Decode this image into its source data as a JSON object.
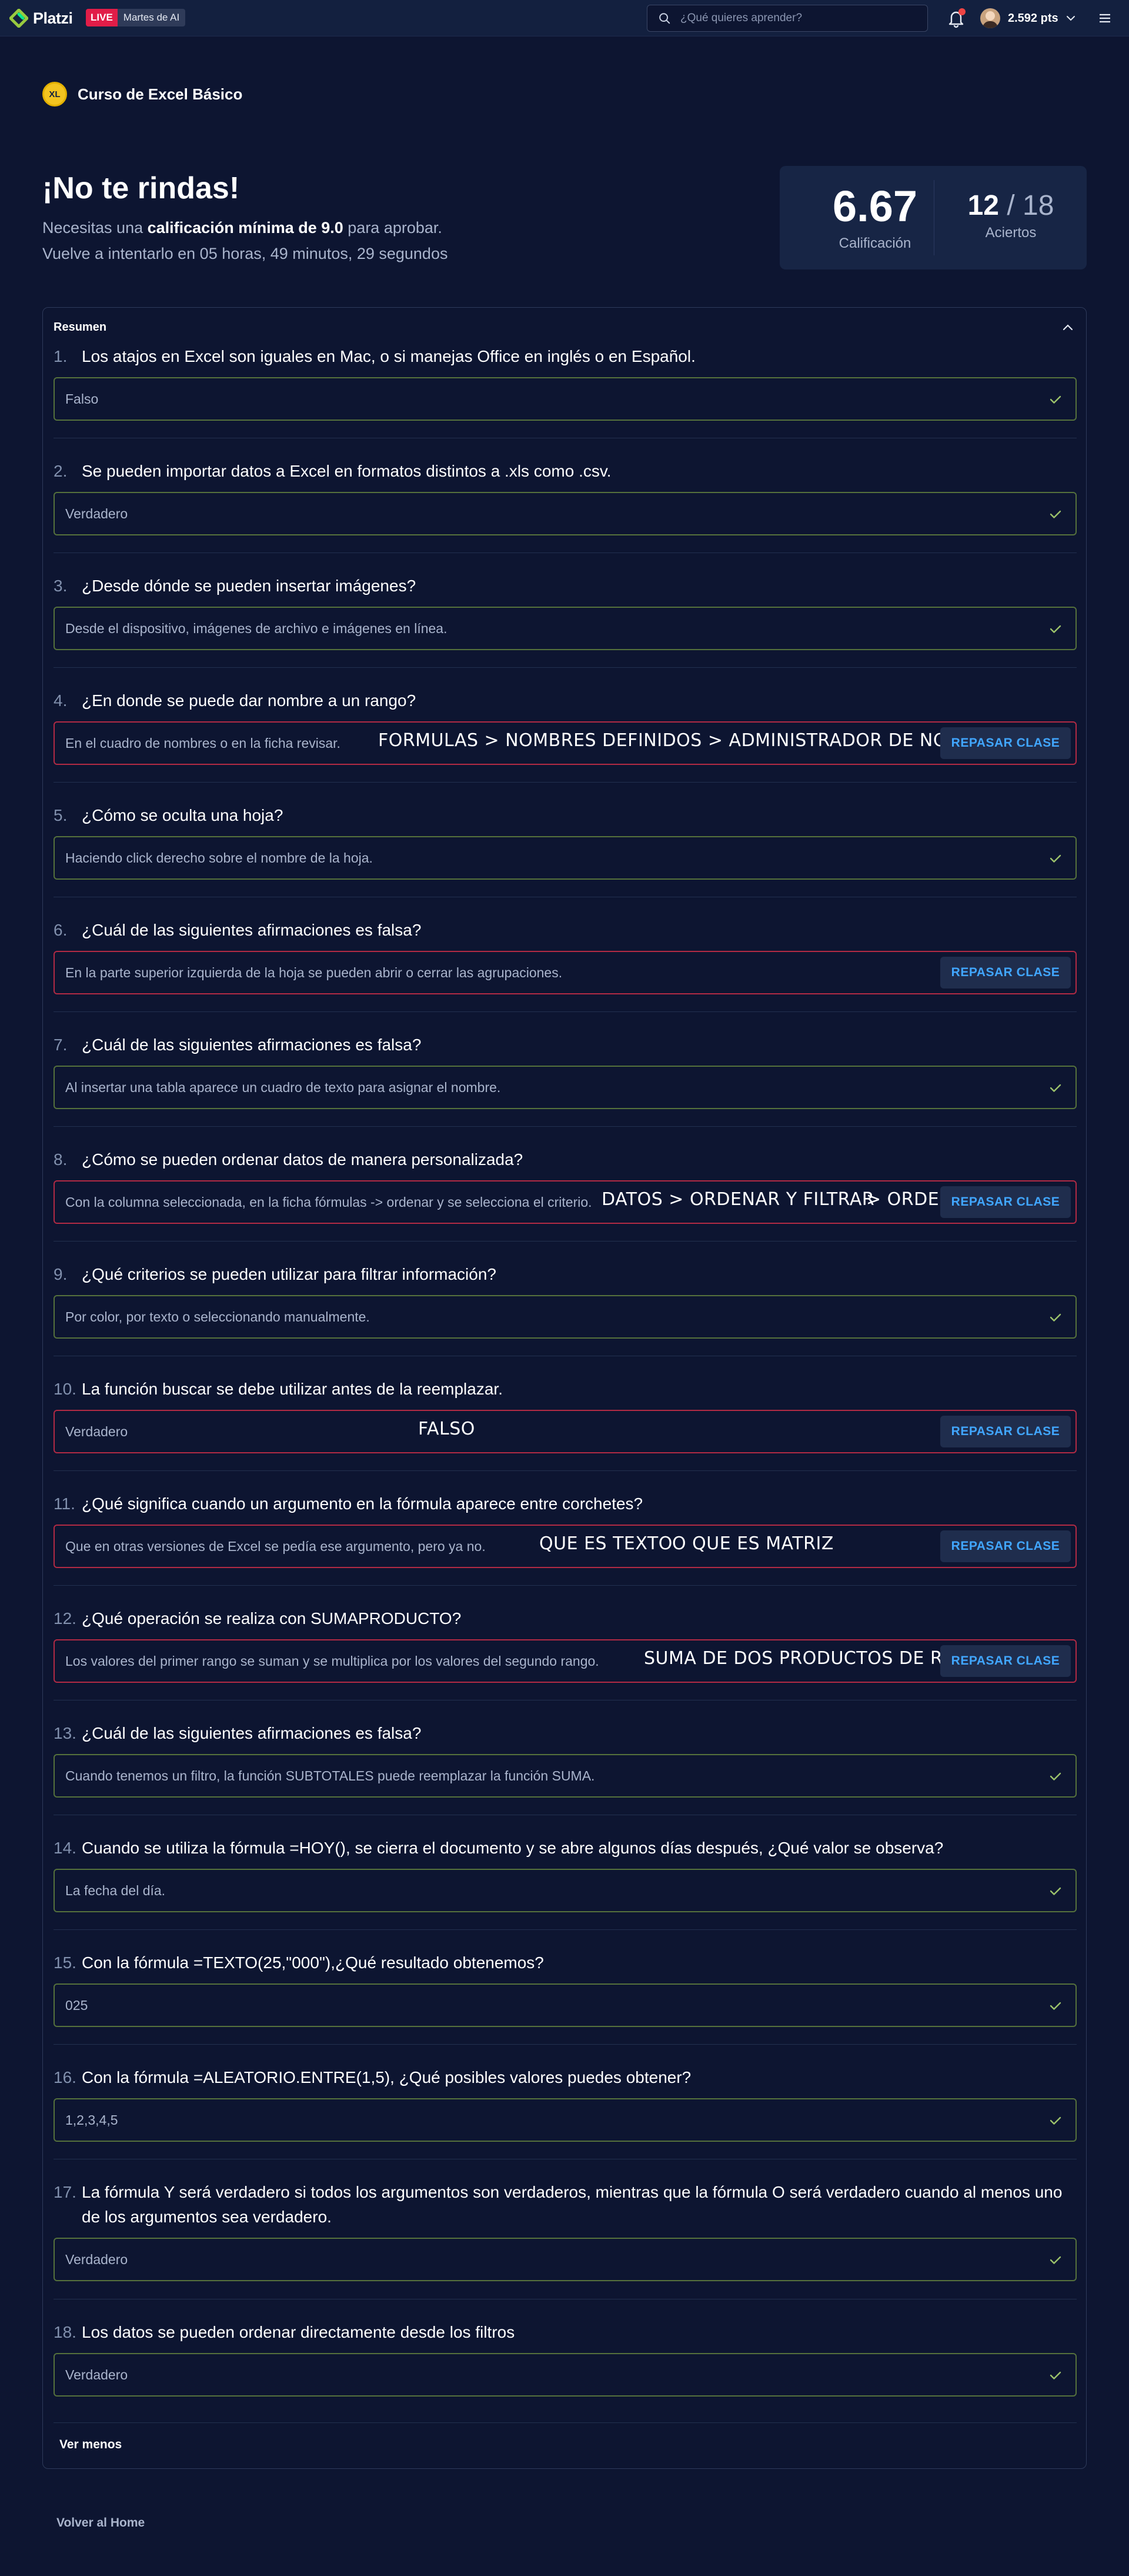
{
  "header": {
    "brand": "Platzi",
    "live_label": "LIVE",
    "live_event": "Martes de AI",
    "search_placeholder": "¿Qué quieres aprender?",
    "points": "2.592 pts"
  },
  "course": {
    "badge": "XL",
    "name": "Curso de Excel Básico"
  },
  "result": {
    "heading": "¡No te rindas!",
    "requirement_prefix": "Necesitas una",
    "requirement_bold": "calificación mínima de 9.0",
    "requirement_suffix": "para aprobar.",
    "retry": "Vuelve a intentarlo en 05 horas, 49 minutos, 29 segundos",
    "score": "6.67",
    "score_label": "Calificación",
    "hits": "12",
    "hits_total": "/ 18",
    "hits_label": "Aciertos"
  },
  "summary": {
    "title": "Resumen",
    "review_label": "REPASAR CLASE",
    "show_less": "Ver menos",
    "questions": [
      {
        "num": "1.",
        "text": "Los atajos en Excel son iguales en Mac, o si manejas Office en inglés o en Español.",
        "answer": "Falso"
      },
      {
        "num": "2.",
        "text": "Se pueden importar datos a Excel en formatos distintos a .xls como .csv.",
        "answer": "Verdadero"
      },
      {
        "num": "3.",
        "text": "¿Desde dónde se pueden insertar imágenes?",
        "answer": "Desde el dispositivo, imágenes de archivo e imágenes en línea."
      },
      {
        "num": "4.",
        "text": "¿En donde se puede dar nombre a un rango?",
        "answer": "En el cuadro de nombres o en la ficha revisar.",
        "note": "FORMULAS > NOMBRES DEFINIDOS > ADMINISTRADOR DE NOMBRES"
      },
      {
        "num": "5.",
        "text": "¿Cómo se oculta una hoja?",
        "answer": "Haciendo click derecho sobre el nombre de la hoja."
      },
      {
        "num": "6.",
        "text": "¿Cuál de las siguientes afirmaciones es falsa?",
        "answer": "En la parte superior izquierda de la hoja se pueden abrir o cerrar las agrupaciones."
      },
      {
        "num": "7.",
        "text": "¿Cuál de las siguientes afirmaciones es falsa?",
        "answer": "Al insertar una tabla aparece un cuadro de texto para asignar el nombre."
      },
      {
        "num": "8.",
        "text": "¿Cómo se pueden ordenar datos de manera personalizada?",
        "answer": "Con la columna seleccionada, en la ficha fórmulas -> ordenar y se selecciona el criterio.",
        "note": "DATOS > ORDENAR Y FILTRAR",
        "note2": "> ORDENAR"
      },
      {
        "num": "9.",
        "text": "¿Qué criterios se pueden utilizar para filtrar información?",
        "answer": "Por color, por texto o seleccionando manualmente."
      },
      {
        "num": "10.",
        "text": "La función buscar se debe utilizar antes de la reemplazar.",
        "answer": "Verdadero",
        "note": "FALSO"
      },
      {
        "num": "11.",
        "text": "¿Qué significa cuando un argumento en la fórmula aparece entre corchetes?",
        "answer": "Que en otras versiones de Excel se pedía ese argumento, pero ya no.",
        "note": "QUE ES TEXTO",
        "note2": "O QUE ES MATRIZ"
      },
      {
        "num": "12.",
        "text": "¿Qué operación se realiza con SUMAPRODUCTO?",
        "answer": "Los valores del primer rango se suman y se multiplica por los valores del segundo rango.",
        "note": "SUMA DE DOS PRODUCTOS DE RANGOS"
      },
      {
        "num": "13.",
        "text": "¿Cuál de las siguientes afirmaciones es falsa?",
        "answer": "Cuando tenemos un filtro, la función SUBTOTALES puede reemplazar la función SUMA."
      },
      {
        "num": "14.",
        "text": "Cuando se utiliza la fórmula =HOY(), se cierra el documento y se abre algunos días después, ¿Qué valor se observa?",
        "answer": "La fecha del día."
      },
      {
        "num": "15.",
        "text": "Con la fórmula =TEXTO(25,\"000\"),¿Qué resultado obtenemos?",
        "answer": "025"
      },
      {
        "num": "16.",
        "text": "Con la fórmula =ALEATORIO.ENTRE(1,5), ¿Qué posibles valores puedes obtener?",
        "answer": "1,2,3,4,5"
      },
      {
        "num": "17.",
        "text": "La fórmula Y será verdadero si todos los argumentos son verdaderos, mientras que la fórmula O será verdadero cuando al menos uno de los argumentos sea verdadero.",
        "answer": "Verdadero"
      },
      {
        "num": "18.",
        "text": "Los datos se pueden ordenar directamente desde los filtros",
        "answer": "Verdadero"
      }
    ]
  },
  "footer": {
    "home_link": "Volver al Home"
  },
  "colors": {
    "background": "#0d1531",
    "correct_border": "#55713c",
    "wrong_border": "#b12a44",
    "link": "#41a6ff",
    "brand_green": "#98ca3f"
  }
}
